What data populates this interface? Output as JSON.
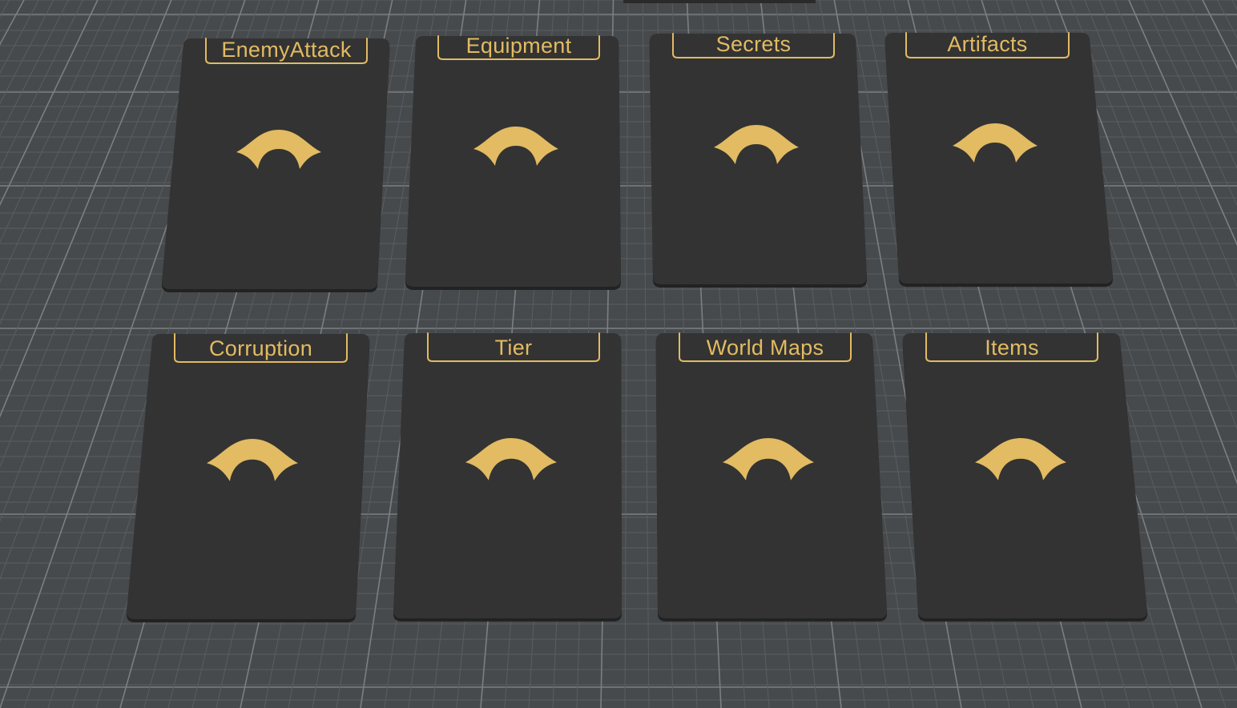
{
  "colors": {
    "floor": "#464a4c",
    "grid_minor": "#5a5e60",
    "grid_major": "#7b7f81",
    "card": "#333333",
    "card_edge": "#222222",
    "gold": "#e2bb62"
  },
  "table": {
    "cards": [
      {
        "label": "EnemyAttack",
        "emblem": "crescent-eye-icon"
      },
      {
        "label": "Equipment",
        "emblem": "crescent-eye-icon"
      },
      {
        "label": "Secrets",
        "emblem": "crescent-eye-icon"
      },
      {
        "label": "Artifacts",
        "emblem": "crescent-eye-icon"
      },
      {
        "label": "Corruption",
        "emblem": "crescent-eye-icon"
      },
      {
        "label": "Tier",
        "emblem": "crescent-eye-icon"
      },
      {
        "label": "World Maps",
        "emblem": "crescent-eye-icon"
      },
      {
        "label": "Items",
        "emblem": "crescent-eye-icon"
      }
    ]
  }
}
